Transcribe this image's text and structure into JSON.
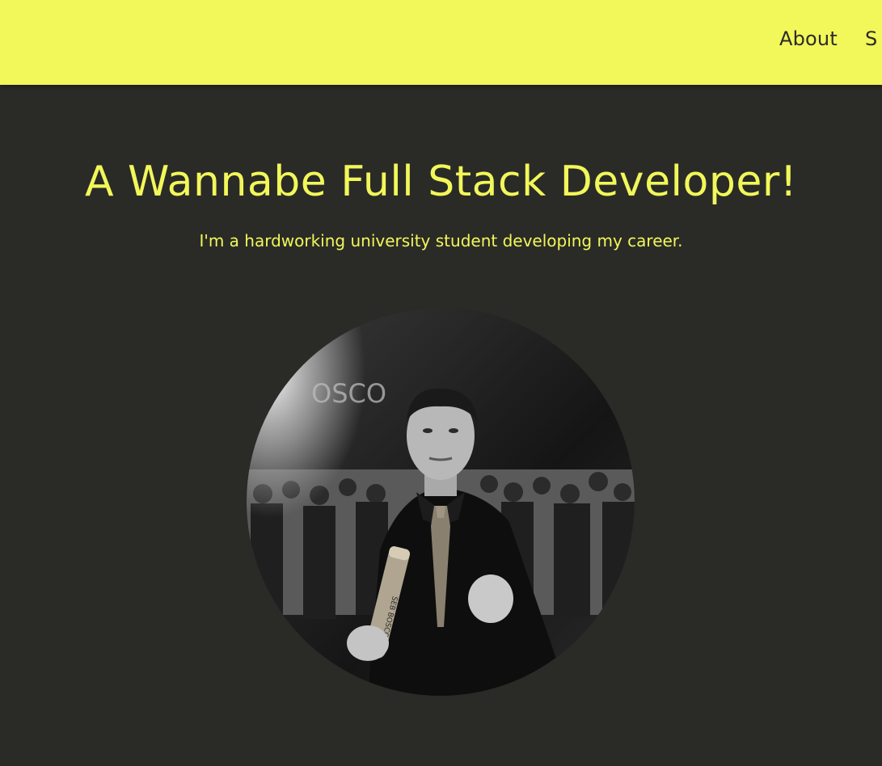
{
  "nav": {
    "links": [
      "About",
      "S"
    ]
  },
  "hero": {
    "title": "A Wannabe Full Stack Developer!",
    "subtitle": "I'm a hardworking university student developing my career."
  },
  "profile": {
    "image_alt": "profile-photo",
    "backdrop_text": "OSCO",
    "tube_text": "SEB BOSCO"
  },
  "colors": {
    "accent": "#f2f75a",
    "background": "#2a2b27",
    "nav_text": "#2c2b25"
  }
}
